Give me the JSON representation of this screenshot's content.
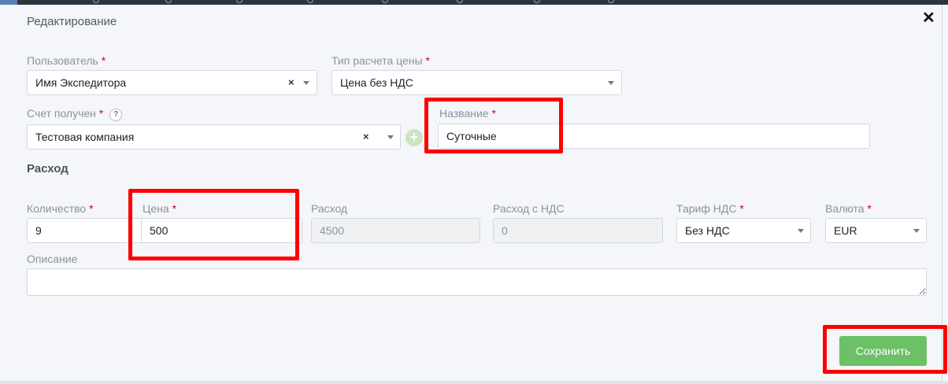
{
  "dialog": {
    "title": "Редактирование",
    "close_label": "✕"
  },
  "fields": {
    "user": {
      "label": "Пользователь",
      "required": "*",
      "value": "Имя Экспедитора"
    },
    "price_type": {
      "label": "Тип расчета цены",
      "required": "*",
      "value": "Цена без НДС"
    },
    "invoice": {
      "label": "Счет получен",
      "required": "*",
      "help": "?",
      "value": "Тестовая компания"
    },
    "name": {
      "label": "Название",
      "required": "*",
      "value": "Суточные"
    }
  },
  "expense": {
    "section_title": "Расход",
    "quantity": {
      "label": "Количество",
      "required": "*",
      "value": "9"
    },
    "price": {
      "label": "Цена",
      "required": "*",
      "value": "500"
    },
    "expense": {
      "label": "Расход",
      "value": "4500"
    },
    "expense_vat": {
      "label": "Расход с НДС",
      "value": "0"
    },
    "vat_rate": {
      "label": "Тариф НДС",
      "required": "*",
      "value": "Без НДС"
    },
    "currency": {
      "label": "Валюта",
      "required": "*",
      "value": "EUR"
    },
    "description": {
      "label": "Описание",
      "value": ""
    }
  },
  "actions": {
    "save_label": "Сохранить",
    "add_label": "+",
    "clear_label": "×"
  },
  "colors": {
    "highlight": "#ff0000",
    "save_button": "#6cc167",
    "required": "#d0021b"
  }
}
